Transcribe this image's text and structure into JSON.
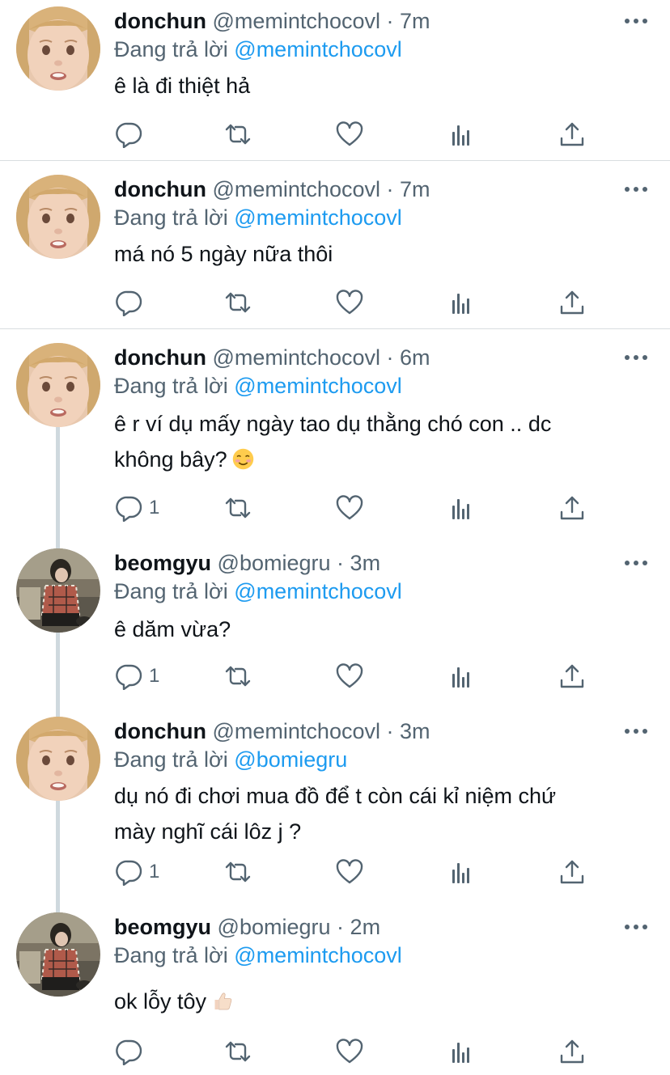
{
  "tweets": [
    {
      "avatar": "child-face",
      "name": "donchun",
      "handle": "@memintchocovl",
      "sep": "·",
      "time": "7m",
      "reply_prefix": "Đang trả lời",
      "reply_to": "@memintchocovl",
      "text_lines": [
        "ê là đi thiệt hả"
      ],
      "reply_count": ""
    },
    {
      "avatar": "child-face",
      "name": "donchun",
      "handle": "@memintchocovl",
      "sep": "·",
      "time": "7m",
      "reply_prefix": "Đang trả lời",
      "reply_to": "@memintchocovl",
      "text_lines": [
        "má nó 5 ngày nữa thôi"
      ],
      "reply_count": ""
    },
    {
      "avatar": "child-face",
      "name": "donchun",
      "handle": "@memintchocovl",
      "sep": "·",
      "time": "6m",
      "reply_prefix": "Đang trả lời",
      "reply_to": "@memintchocovl",
      "text_lines": [
        "ê r ví dụ mấy ngày tao dụ thằng chó con .. dc",
        "không bây?"
      ],
      "emoji": "smiling-face-emoji",
      "reply_count": "1"
    },
    {
      "avatar": "boy-photo",
      "name": "beomgyu",
      "handle": "@bomiegru",
      "sep": "·",
      "time": "3m",
      "reply_prefix": "Đang trả lời",
      "reply_to": "@memintchocovl",
      "text_lines": [
        "ê dăm vừa?"
      ],
      "reply_count": "1"
    },
    {
      "avatar": "child-face",
      "name": "donchun",
      "handle": "@memintchocovl",
      "sep": "·",
      "time": "3m",
      "reply_prefix": "Đang trả lời",
      "reply_to": "@bomiegru",
      "text_lines": [
        "dụ nó đi chơi mua đồ để t còn cái kỉ niệm chứ",
        "mày nghĩ cái lôz j ?"
      ],
      "reply_count": "1"
    },
    {
      "avatar": "boy-photo",
      "name": "beomgyu",
      "handle": "@bomiegru",
      "sep": "·",
      "time": "2m",
      "reply_prefix": "Đang trả lời",
      "reply_to": "@memintchocovl",
      "text_lines": [
        "ok lỗy tôy"
      ],
      "emoji": "thumbs-up-emoji",
      "reply_count": ""
    }
  ],
  "icons": {
    "reply": "reply-icon",
    "retweet": "retweet-icon",
    "like": "heart-icon",
    "stats": "stats-icon",
    "share": "share-icon",
    "more": "more-icon"
  },
  "colors": {
    "link": "#1d9bf0",
    "secondary": "#536471",
    "text": "#0f1419",
    "thread_line": "#cfd9de"
  }
}
